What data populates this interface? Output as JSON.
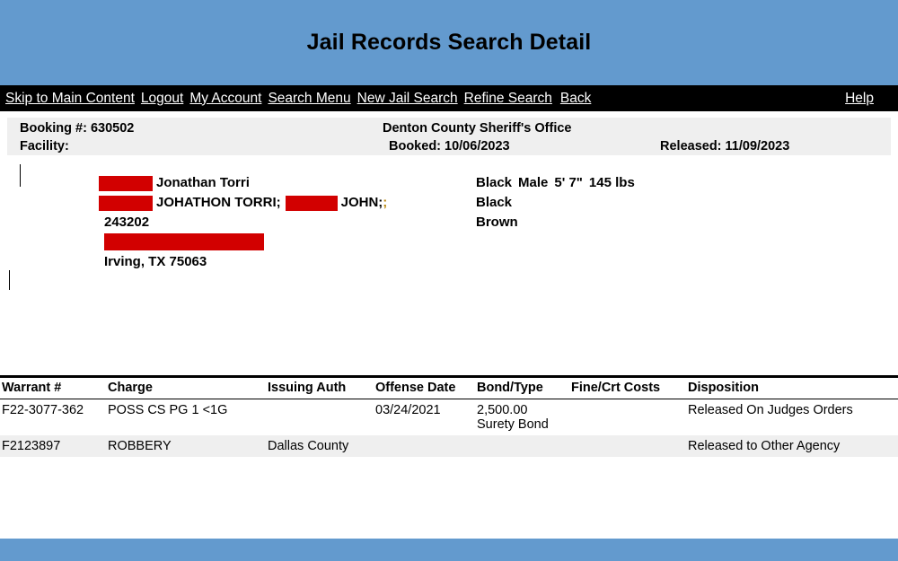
{
  "header": {
    "title": "Jail Records Search Detail",
    "background_color": "#639ace"
  },
  "navbar": {
    "background_color": "#000000",
    "link_color": "#ffffff",
    "left_links": [
      {
        "label": "Skip to Main Content",
        "name": "skip-to-main-content"
      },
      {
        "label": "Logout",
        "name": "logout"
      },
      {
        "label": "My Account",
        "name": "my-account"
      },
      {
        "label": "Search Menu",
        "name": "search-menu"
      },
      {
        "label": "New Jail Search",
        "name": "new-jail-search"
      },
      {
        "label": "Refine Search",
        "name": "refine-search"
      },
      {
        "label": "Back",
        "name": "back"
      }
    ],
    "right_links": [
      {
        "label": "Help",
        "name": "help"
      }
    ]
  },
  "booking": {
    "booking_label": "Booking #: 630502",
    "facility_label": "Facility:",
    "agency": "Denton County Sheriff's Office",
    "booked": "Booked: 10/06/2023",
    "released": "Released: 11/09/2023",
    "background_color": "#efefef"
  },
  "subject": {
    "redaction_color": "#d20000",
    "name": "Jonathan Torri",
    "alias_1": "JOHATHON TORRI;",
    "alias_2": "JOHN;",
    "alias_clipped": ";",
    "id_number": "243202",
    "city_state_zip": "Irving, TX 75063",
    "race": "Black",
    "sex": "Male",
    "height": "5' 7\"",
    "weight": "145 lbs",
    "hair": "Black",
    "eyes": "Brown"
  },
  "charges_table": {
    "columns": [
      "Warrant #",
      "Charge",
      "Issuing Auth",
      "Offense Date",
      "Bond/Type",
      "Fine/Crt Costs",
      "Disposition"
    ],
    "rows": [
      {
        "warrant": "F22-3077-362",
        "charge": "POSS CS PG 1 <1G",
        "issuing_auth": "",
        "offense_date": "03/24/2021",
        "bond_type": "2,500.00\nSurety Bond",
        "fine_costs": "",
        "disposition": "Released On Judges Orders"
      },
      {
        "warrant": "F2123897",
        "charge": "ROBBERY",
        "issuing_auth": "Dallas County",
        "offense_date": "",
        "bond_type": "",
        "fine_costs": "",
        "disposition": "Released to Other Agency"
      }
    ]
  },
  "footer": {
    "background_color": "#639ace"
  }
}
